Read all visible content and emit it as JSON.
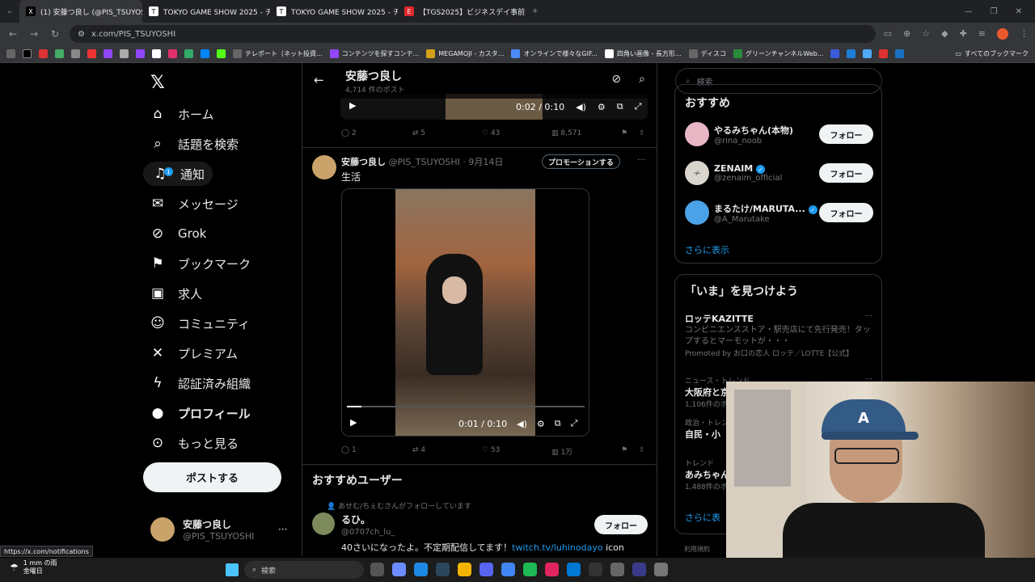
{
  "browser": {
    "tabs": [
      {
        "label": "(1) 安藤つ良し (@PIS_TSUYOSHI",
        "icon": "x-icon",
        "active": true
      },
      {
        "label": "TOKYO GAME SHOW 2025 - チ",
        "icon": "tgs-icon"
      },
      {
        "label": "TOKYO GAME SHOW 2025 - チ",
        "icon": "tgs-icon"
      },
      {
        "label": "【TGS2025】ビジネスデイ事前登録",
        "icon": "e-icon"
      }
    ],
    "url": "x.com/PIS_TSUYOSHI",
    "bookmarks": [
      "テレポート（ネット投資...",
      "コンテンツを探すコンテ...",
      "MEGAMOJI - カスタ...",
      "オンラインで様々なGIF...",
      "四角い画像 - 長方形...",
      "ディスコ",
      "グリーンチャンネルWeb..."
    ],
    "all_bookmarks": "すべてのブックマーク"
  },
  "nav": {
    "items": [
      {
        "label": "ホーム",
        "icon": "home-icon",
        "glyph": "⌂"
      },
      {
        "label": "話題を検索",
        "icon": "search-icon",
        "glyph": "⌕"
      },
      {
        "label": "通知",
        "icon": "bell-icon",
        "glyph": "♫",
        "badge": "1"
      },
      {
        "label": "メッセージ",
        "icon": "mail-icon",
        "glyph": "✉"
      },
      {
        "label": "Grok",
        "icon": "grok-icon",
        "glyph": "⊘"
      },
      {
        "label": "ブックマーク",
        "icon": "bookmark-icon",
        "glyph": "⚑"
      },
      {
        "label": "求人",
        "icon": "briefcase-icon",
        "glyph": "▣"
      },
      {
        "label": "コミュニティ",
        "icon": "community-icon",
        "glyph": "☺"
      },
      {
        "label": "プレミアム",
        "icon": "x-premium-icon",
        "glyph": "✕"
      },
      {
        "label": "認証済み組織",
        "icon": "lightning-icon",
        "glyph": "ϟ"
      },
      {
        "label": "プロフィール",
        "icon": "person-icon",
        "glyph": "●"
      },
      {
        "label": "もっと見る",
        "icon": "more-circle-icon",
        "glyph": "⊙"
      }
    ],
    "post_label": "ポストする",
    "account": {
      "name": "安藤つ良し",
      "handle": "@PIS_TSUYOSHI"
    }
  },
  "profile_header": {
    "name": "安藤つ良し",
    "post_count": "4,714 件のポスト"
  },
  "top_video": {
    "time": "0:02 / 0:10",
    "replies": "2",
    "reposts": "5",
    "likes": "43",
    "views": "8,571"
  },
  "tweet": {
    "name": "安藤つ良し",
    "handle": "@PIS_TSUYOSHI",
    "date": "9月14日",
    "promote_label": "プロモーションする",
    "text": "生活",
    "video_time": "0:01 / 0:10",
    "video_progress": 0.06,
    "replies": "1",
    "reposts": "4",
    "likes": "53",
    "views": "1万"
  },
  "recommended": {
    "title": "おすすめユーザー",
    "followed_by": "あせむ/ちぇむさんがフォローしています",
    "name": "るひ。",
    "handle": "@0707ch_lu_",
    "follow_label": "フォロー",
    "bio_text": "40さいになったよ。不定期配信してます！",
    "bio_link": "twitch.tv/luhinodayo",
    "bio_tail": "icon"
  },
  "sidebar": {
    "search_placeholder": "検索",
    "who_to_follow": {
      "title": "おすすめ",
      "users": [
        {
          "name": "やるみちゃん(本物)",
          "handle": "@rina_noob",
          "verified": false,
          "color": "#e9b6c6"
        },
        {
          "name": "ZENAIM",
          "handle": "@zenaim_official",
          "verified": true,
          "color": "#d9d5cc"
        },
        {
          "name": "まるたけ/MARUTA...",
          "handle": "@A_Marutake",
          "verified": true,
          "color": "#4aa3e8"
        }
      ],
      "follow_label": "フォロー",
      "show_more": "さらに表示"
    },
    "trends": {
      "title": "「いま」を見つけよう",
      "items": [
        {
          "category": "",
          "title": "ロッテKAZITTE",
          "desc": "コンビニエンスストア・駅売店にて先行発売！タップするとマーモットが・・・",
          "meta": "Promoted by お口の恋人 ロッテ／LOTTE【公式】"
        },
        {
          "category": "ニュース・トレンド",
          "title": "大阪府と京",
          "meta": "1,106件のポ"
        },
        {
          "category": "政治・トレン",
          "title": "自民・小",
          "meta": ""
        },
        {
          "category": "トレンド",
          "title": "あみちゃん",
          "meta": "1,488件のポ"
        }
      ],
      "show_more": "さらに表"
    },
    "footer": "利用規約"
  },
  "status_url": "https://x.com/notifications",
  "taskbar": {
    "weather_line1": "1 mm の雨",
    "weather_line2": "金曜日",
    "search": "検索"
  }
}
